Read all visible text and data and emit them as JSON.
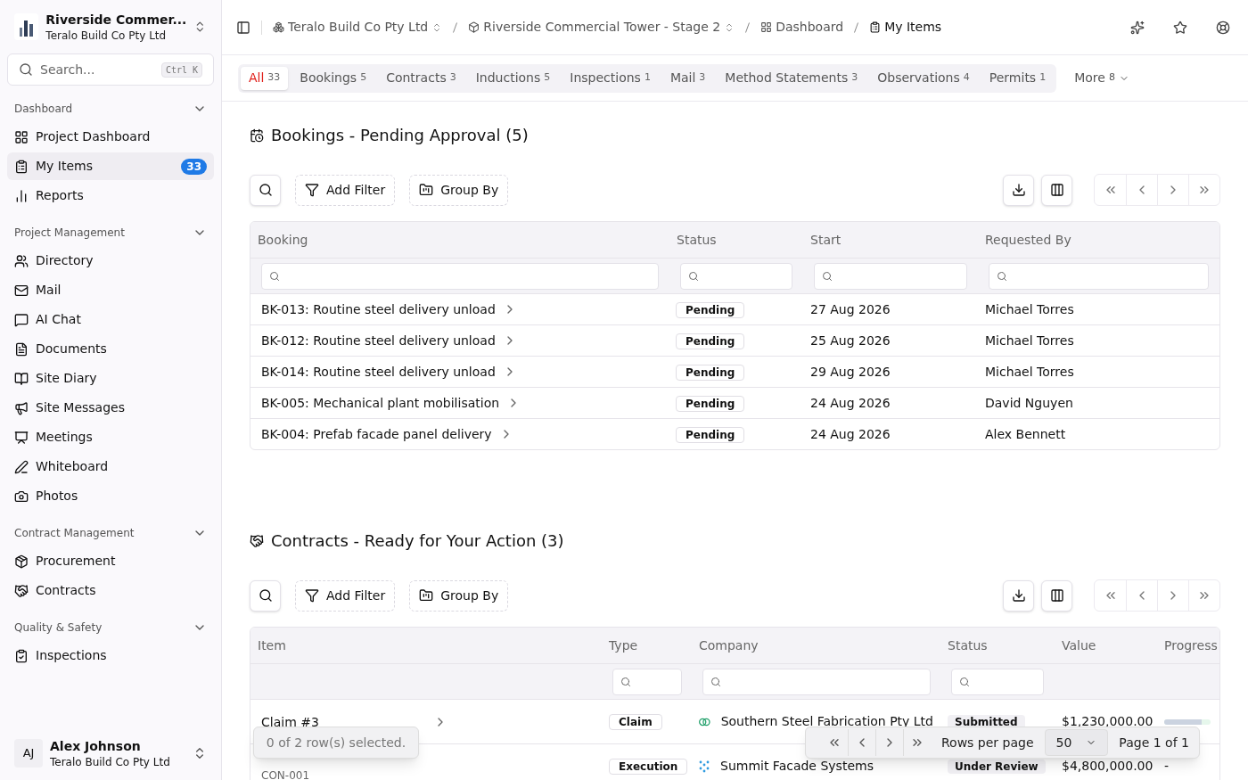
{
  "sidebar": {
    "project": {
      "name": "Riverside Commer...",
      "org": "Teralo Build Co Pty Ltd"
    },
    "search": {
      "placeholder": "Search...",
      "shortcut": "Ctrl K"
    },
    "sections": [
      {
        "title": "Dashboard",
        "expanded": true,
        "items": [
          {
            "label": "Project Dashboard",
            "selected": false
          },
          {
            "label": "My Items",
            "selected": true,
            "badge": "33"
          },
          {
            "label": "Reports",
            "selected": false
          }
        ]
      },
      {
        "title": "Project Management",
        "expanded": true,
        "items": [
          {
            "label": "Directory",
            "selected": false
          },
          {
            "label": "Mail",
            "selected": false
          },
          {
            "label": "AI Chat",
            "selected": false
          },
          {
            "label": "Documents",
            "selected": false
          },
          {
            "label": "Site Diary",
            "selected": false
          },
          {
            "label": "Site Messages",
            "selected": false
          },
          {
            "label": "Meetings",
            "selected": false
          },
          {
            "label": "Whiteboard",
            "selected": false
          },
          {
            "label": "Photos",
            "selected": false
          }
        ]
      },
      {
        "title": "Contract Management",
        "expanded": true,
        "items": [
          {
            "label": "Procurement",
            "selected": false
          },
          {
            "label": "Contracts",
            "selected": false
          }
        ]
      },
      {
        "title": "Quality & Safety",
        "expanded": true,
        "items": [
          {
            "label": "Inspections",
            "selected": false
          }
        ]
      }
    ],
    "user": {
      "initials": "AJ",
      "name": "Alex Johnson",
      "org": "Teralo Build Co Pty Ltd"
    }
  },
  "breadcrumbs": [
    {
      "label": "Teralo Build Co Pty Ltd",
      "switcher": true,
      "current": false
    },
    {
      "label": "Riverside Commercial Tower - Stage 2",
      "switcher": true,
      "current": false
    },
    {
      "label": "Dashboard",
      "switcher": false,
      "current": false
    },
    {
      "label": "My Items",
      "switcher": false,
      "current": true
    }
  ],
  "tabs": [
    {
      "label": "All",
      "count": "33",
      "selected": true
    },
    {
      "label": "Bookings",
      "count": "5",
      "selected": false
    },
    {
      "label": "Contracts",
      "count": "3",
      "selected": false
    },
    {
      "label": "Inductions",
      "count": "5",
      "selected": false
    },
    {
      "label": "Inspections",
      "count": "1",
      "selected": false
    },
    {
      "label": "Mail",
      "count": "3",
      "selected": false
    },
    {
      "label": "Method Statements",
      "count": "3",
      "selected": false
    },
    {
      "label": "Observations",
      "count": "4",
      "selected": false
    },
    {
      "label": "Permits",
      "count": "1",
      "selected": false
    }
  ],
  "more": {
    "label": "More",
    "count": "8"
  },
  "bookings": {
    "title": "Bookings - Pending Approval (5)",
    "add_filter": "Add Filter",
    "group_by": "Group By",
    "columns": [
      "Booking",
      "Status",
      "Start",
      "Requested By"
    ],
    "rows": [
      {
        "booking": "BK-013: Routine steel delivery unload",
        "status": "Pending",
        "start": "27 Aug 2026",
        "requested_by": "Michael Torres"
      },
      {
        "booking": "BK-012: Routine steel delivery unload",
        "status": "Pending",
        "start": "25 Aug 2026",
        "requested_by": "Michael Torres"
      },
      {
        "booking": "BK-014: Routine steel delivery unload",
        "status": "Pending",
        "start": "29 Aug 2026",
        "requested_by": "Michael Torres"
      },
      {
        "booking": "BK-005: Mechanical plant mobilisation",
        "status": "Pending",
        "start": "24 Aug 2026",
        "requested_by": "David Nguyen"
      },
      {
        "booking": "BK-004: Prefab facade panel delivery",
        "status": "Pending",
        "start": "24 Aug 2026",
        "requested_by": "Alex Bennett"
      }
    ]
  },
  "contracts": {
    "title": "Contracts - Ready for Your Action (3)",
    "add_filter": "Add Filter",
    "group_by": "Group By",
    "columns": [
      "Item",
      "Type",
      "Company",
      "Status",
      "Value",
      "Progress"
    ],
    "rows": [
      {
        "item": "Claim #3",
        "type": "Claim",
        "company": "Southern Steel Fabrication Pty Ltd",
        "status": "Submitted",
        "value": "$1,230,000.00",
        "progress": {
          "level": 0.8
        }
      },
      {
        "subtitle": "CON-001",
        "type": "Execution",
        "company": "Summit Facade Systems",
        "status": "Under Review",
        "value": "$4,800,000.00",
        "progress": {
          "text": "-"
        }
      }
    ],
    "selection": "0 of 2 row(s) selected.",
    "pagination": {
      "rows_per_page_label": "Rows per page",
      "rows_per_page": "50",
      "page": "Page 1 of 1"
    }
  }
}
